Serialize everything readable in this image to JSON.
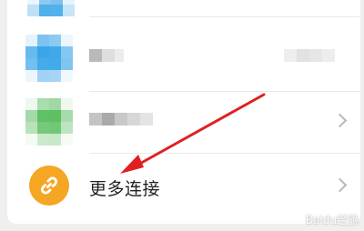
{
  "list": {
    "rows": [
      {
        "label": "",
        "icon": "blurred-blue-app-icon"
      },
      {
        "label": "",
        "icon": "blurred-blue-app-icon"
      },
      {
        "label": "",
        "icon": "blurred-green-app-icon"
      },
      {
        "label": "更多连接",
        "icon": "link-icon"
      }
    ]
  },
  "watermark": "Baidu经验",
  "colors": {
    "link_icon_bg": "#f5a623",
    "arrow": "#e02020"
  }
}
